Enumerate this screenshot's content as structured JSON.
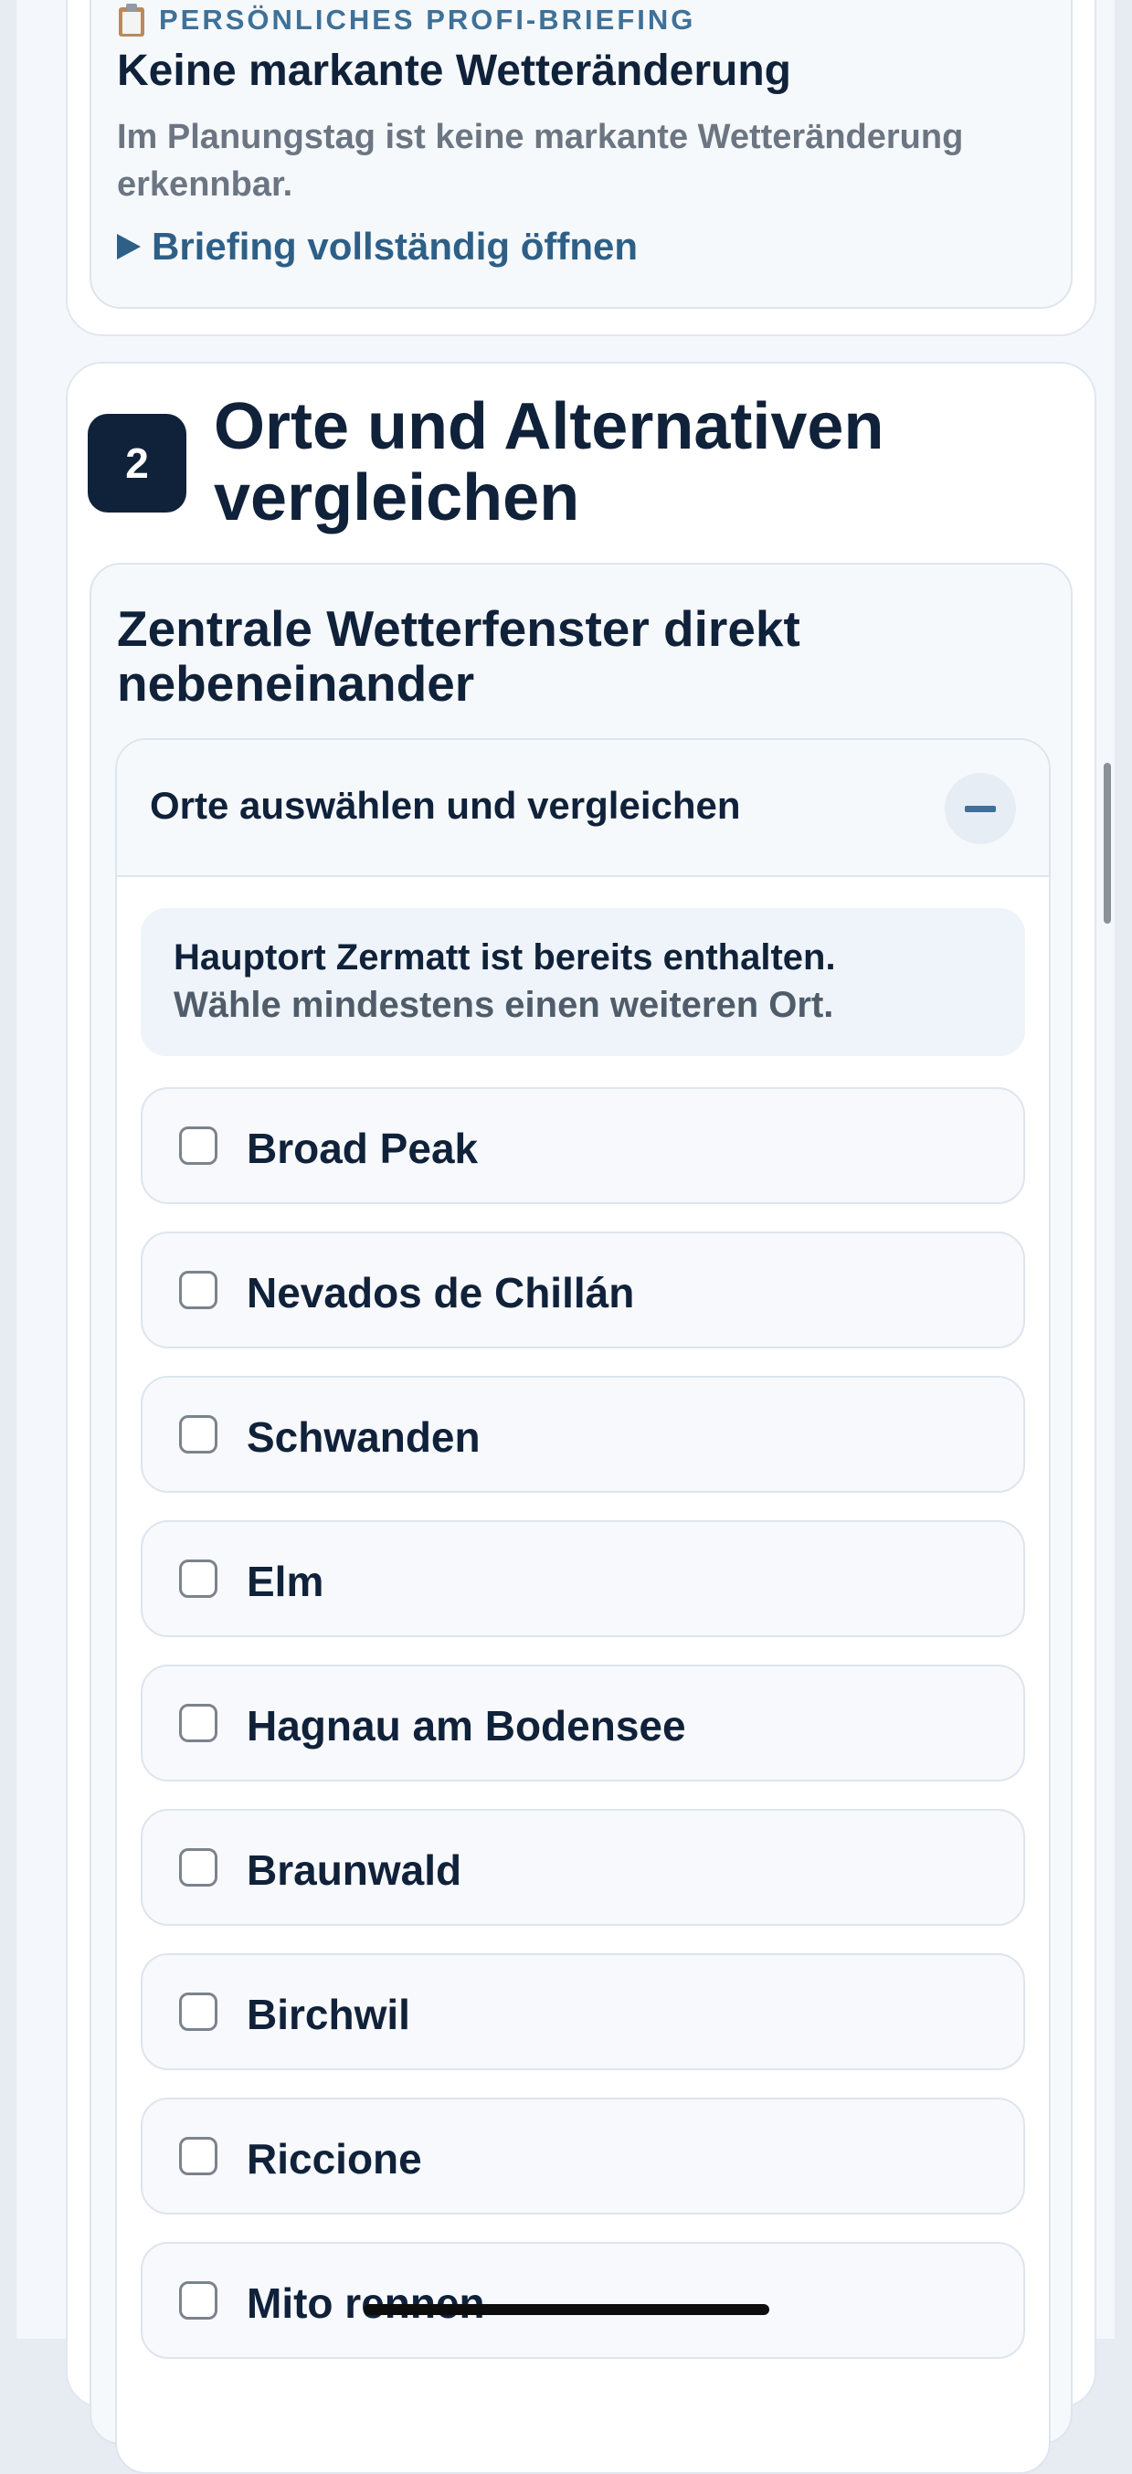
{
  "briefing": {
    "icon": "clipboard-icon",
    "kicker": "PERSÖNLICHES PROFI-BRIEFING",
    "title": "Keine markante Wetteränderung",
    "text": "Im Planungstag ist keine markante Wetteränderung erkennbar.",
    "link": "Briefing vollständig öffnen"
  },
  "compare": {
    "step_number": "2",
    "step_title": "Orte und Alternativen vergleichen",
    "heading": "Zentrale Wetterfenster direkt nebeneinander",
    "accordion": {
      "title": "Orte auswählen und vergleichen",
      "expanded": true,
      "info_line_1": "Hauptort Zermatt ist bereits enthalten.",
      "info_line_2": "Wähle mindestens einen weiteren Ort.",
      "options": [
        {
          "label": "Broad Peak",
          "checked": false
        },
        {
          "label": "Nevados de Chillán",
          "checked": false
        },
        {
          "label": "Schwanden",
          "checked": false
        },
        {
          "label": "Elm",
          "checked": false
        },
        {
          "label": "Hagnau am Bodensee",
          "checked": false
        },
        {
          "label": "Braunwald",
          "checked": false
        },
        {
          "label": "Birchwil",
          "checked": false
        },
        {
          "label": "Riccione",
          "checked": false
        },
        {
          "label": "Mito rennen",
          "checked": false
        }
      ]
    }
  },
  "colors": {
    "accent": "#2d5f87",
    "dark": "#10213a",
    "muted": "#6c7682"
  }
}
